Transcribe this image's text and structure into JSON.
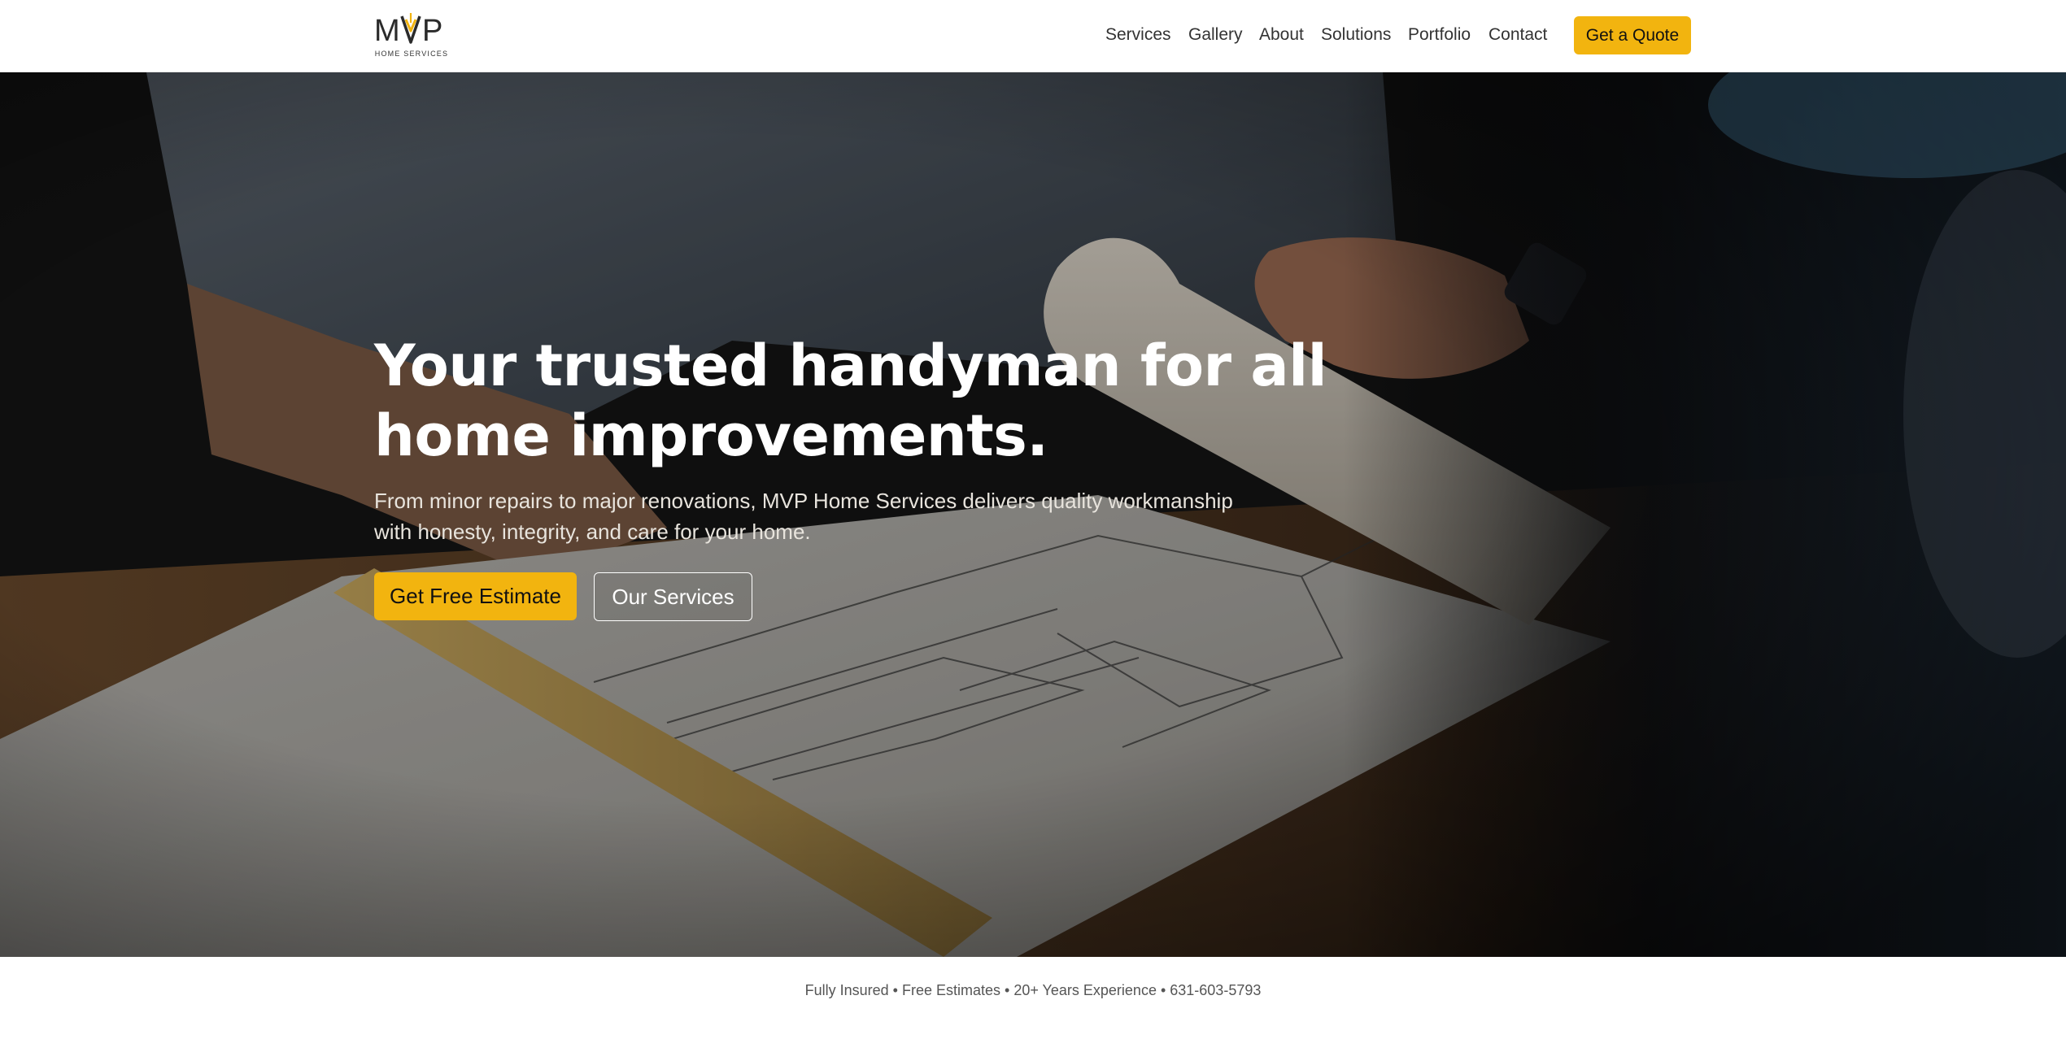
{
  "header": {
    "logo_text": "MVP",
    "logo_subtitle": "HOME SERVICES",
    "nav": [
      "Services",
      "Gallery",
      "About",
      "Solutions",
      "Portfolio",
      "Contact"
    ],
    "cta_label": "Get a Quote"
  },
  "hero": {
    "title_line1": "Your trusted handyman for all",
    "title_line2": "home improvements.",
    "subtitle_line1": "From minor repairs to major renovations, MVP Home Services delivers quality workmanship",
    "subtitle_line2": "with honesty, integrity, and care for your home.",
    "primary_button": "Get Free Estimate",
    "secondary_button": "Our Services"
  },
  "trust_bar": {
    "text": "Fully Insured • Free Estimates • 20+ Years Experience • 631-603-5793"
  },
  "colors": {
    "accent": "#f2b40f",
    "text_dark": "#333333",
    "hero_text": "#ffffff"
  }
}
